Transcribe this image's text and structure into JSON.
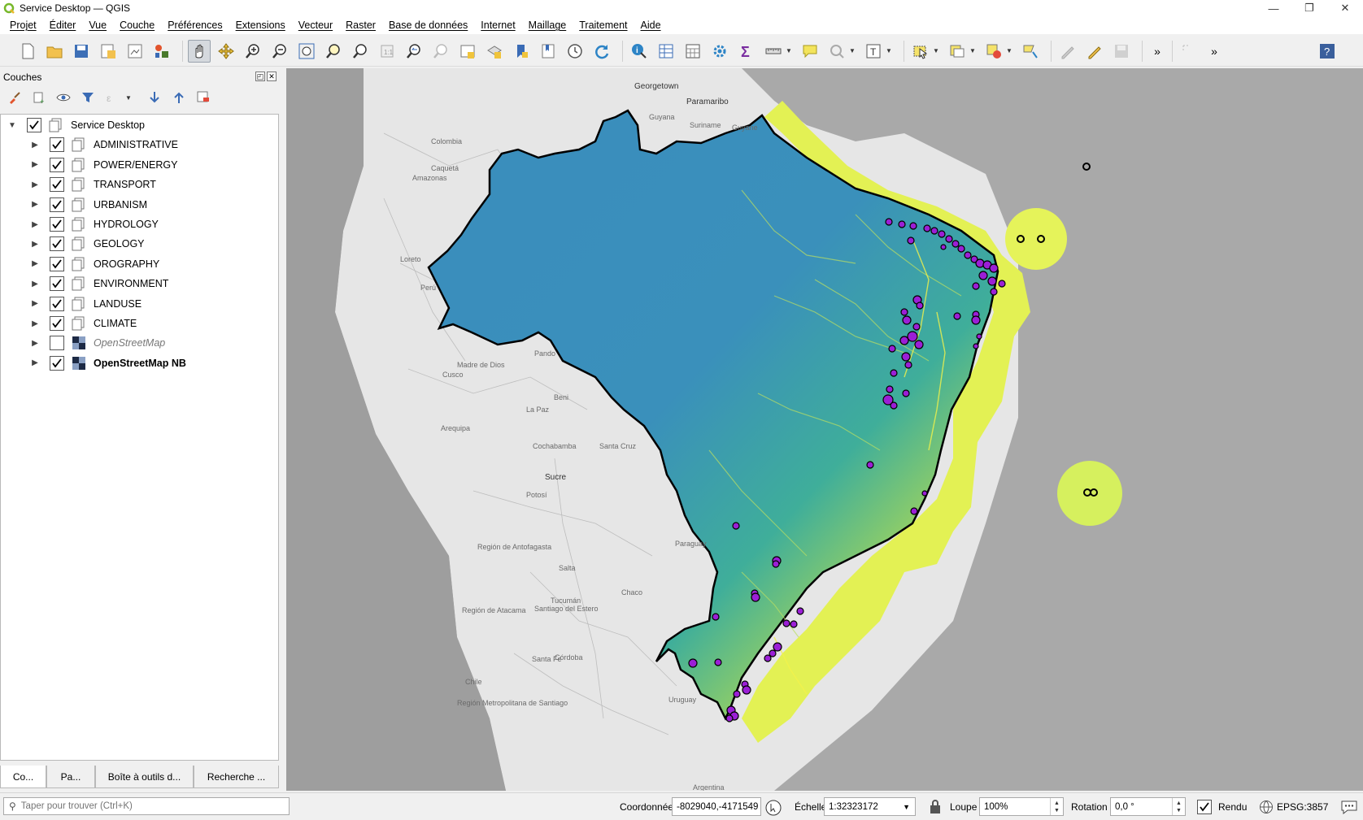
{
  "window": {
    "title": "Service Desktop — QGIS",
    "controls": [
      "—",
      "❐",
      "✕"
    ]
  },
  "menu": [
    "Projet",
    "Éditer",
    "Vue",
    "Couche",
    "Préférences",
    "Extensions",
    "Vecteur",
    "Raster",
    "Base de données",
    "Internet",
    "Maillage",
    "Traitement",
    "Aide"
  ],
  "toolbar": {
    "more_glyph_1": "»",
    "more_glyph_2": "»",
    "active_tool": "pan-map"
  },
  "layers_panel": {
    "title": "Couches",
    "group": {
      "label": "Service Desktop",
      "checked": true
    },
    "layers": [
      {
        "label": "ADMINISTRATIVE",
        "checked": true,
        "kind": "group"
      },
      {
        "label": "POWER/ENERGY",
        "checked": true,
        "kind": "group"
      },
      {
        "label": "TRANSPORT",
        "checked": true,
        "kind": "group"
      },
      {
        "label": "URBANISM",
        "checked": true,
        "kind": "group"
      },
      {
        "label": "HYDROLOGY",
        "checked": true,
        "kind": "group"
      },
      {
        "label": "GEOLOGY",
        "checked": true,
        "kind": "group"
      },
      {
        "label": "OROGRAPHY",
        "checked": true,
        "kind": "group"
      },
      {
        "label": "ENVIRONMENT",
        "checked": true,
        "kind": "group"
      },
      {
        "label": "LANDUSE",
        "checked": true,
        "kind": "group"
      },
      {
        "label": "CLIMATE",
        "checked": true,
        "kind": "group"
      },
      {
        "label": "OpenStreetMap",
        "checked": false,
        "kind": "raster"
      },
      {
        "label": "OpenStreetMap NB",
        "checked": true,
        "kind": "raster"
      }
    ],
    "tabs": [
      "Co...",
      "Pa...",
      "Boîte à outils d...",
      "Recherche ..."
    ]
  },
  "map": {
    "labels": [
      {
        "text": "Georgetown",
        "city": true
      },
      {
        "text": "Paramaribo",
        "city": true
      },
      {
        "text": "Sucre",
        "city": true
      },
      {
        "text": "Guyana",
        "city": false
      },
      {
        "text": "Suriname",
        "city": false
      },
      {
        "text": "Guyane",
        "city": false
      },
      {
        "text": "Colombia",
        "city": false
      },
      {
        "text": "Amazonas",
        "city": false
      },
      {
        "text": "Caquetá",
        "city": false
      },
      {
        "text": "Perú",
        "city": false
      },
      {
        "text": "Loreto",
        "city": false
      },
      {
        "text": "Pando",
        "city": false
      },
      {
        "text": "Beni",
        "city": false
      },
      {
        "text": "La Paz",
        "city": false
      },
      {
        "text": "Cusco",
        "city": false
      },
      {
        "text": "Madre de Dios",
        "city": false
      },
      {
        "text": "Arequipa",
        "city": false
      },
      {
        "text": "Cochabamba",
        "city": false
      },
      {
        "text": "Santa Cruz",
        "city": false
      },
      {
        "text": "Potosí",
        "city": false
      },
      {
        "text": "Paraguay",
        "city": false
      },
      {
        "text": "Región de Antofagasta",
        "city": false
      },
      {
        "text": "Salta",
        "city": false
      },
      {
        "text": "Tucumán",
        "city": false
      },
      {
        "text": "Chaco",
        "city": false
      },
      {
        "text": "Santiago del Estero",
        "city": false
      },
      {
        "text": "Córdoba",
        "city": false
      },
      {
        "text": "Santa Fe",
        "city": false
      },
      {
        "text": "Chile",
        "city": false
      },
      {
        "text": "Uruguay",
        "city": false
      },
      {
        "text": "Argentina",
        "city": false
      },
      {
        "text": "Región de Atacama",
        "city": false
      },
      {
        "text": "Región Metropolitana de Santiago",
        "city": false
      }
    ]
  },
  "statusbar": {
    "locator_placeholder": "Taper pour trouver (Ctrl+K)",
    "coord_label": "Coordonnée",
    "coord_value": "-8029040,-4171549",
    "scale_label": "Échelle",
    "scale_value": "1:32323172",
    "magnifier_label": "Loupe",
    "magnifier_value": "100%",
    "rotation_label": "Rotation",
    "rotation_value": "0,0 °",
    "render_label": "Rendu",
    "render_checked": true,
    "crs": "EPSG:3857"
  },
  "colors": {
    "accent_check": "#000000",
    "raster_low": "#3a8dbd",
    "raster_mid": "#2fb8a0",
    "raster_high": "#f4f24a",
    "point_fill": "#9b1fd6",
    "boundary": "#000000"
  }
}
